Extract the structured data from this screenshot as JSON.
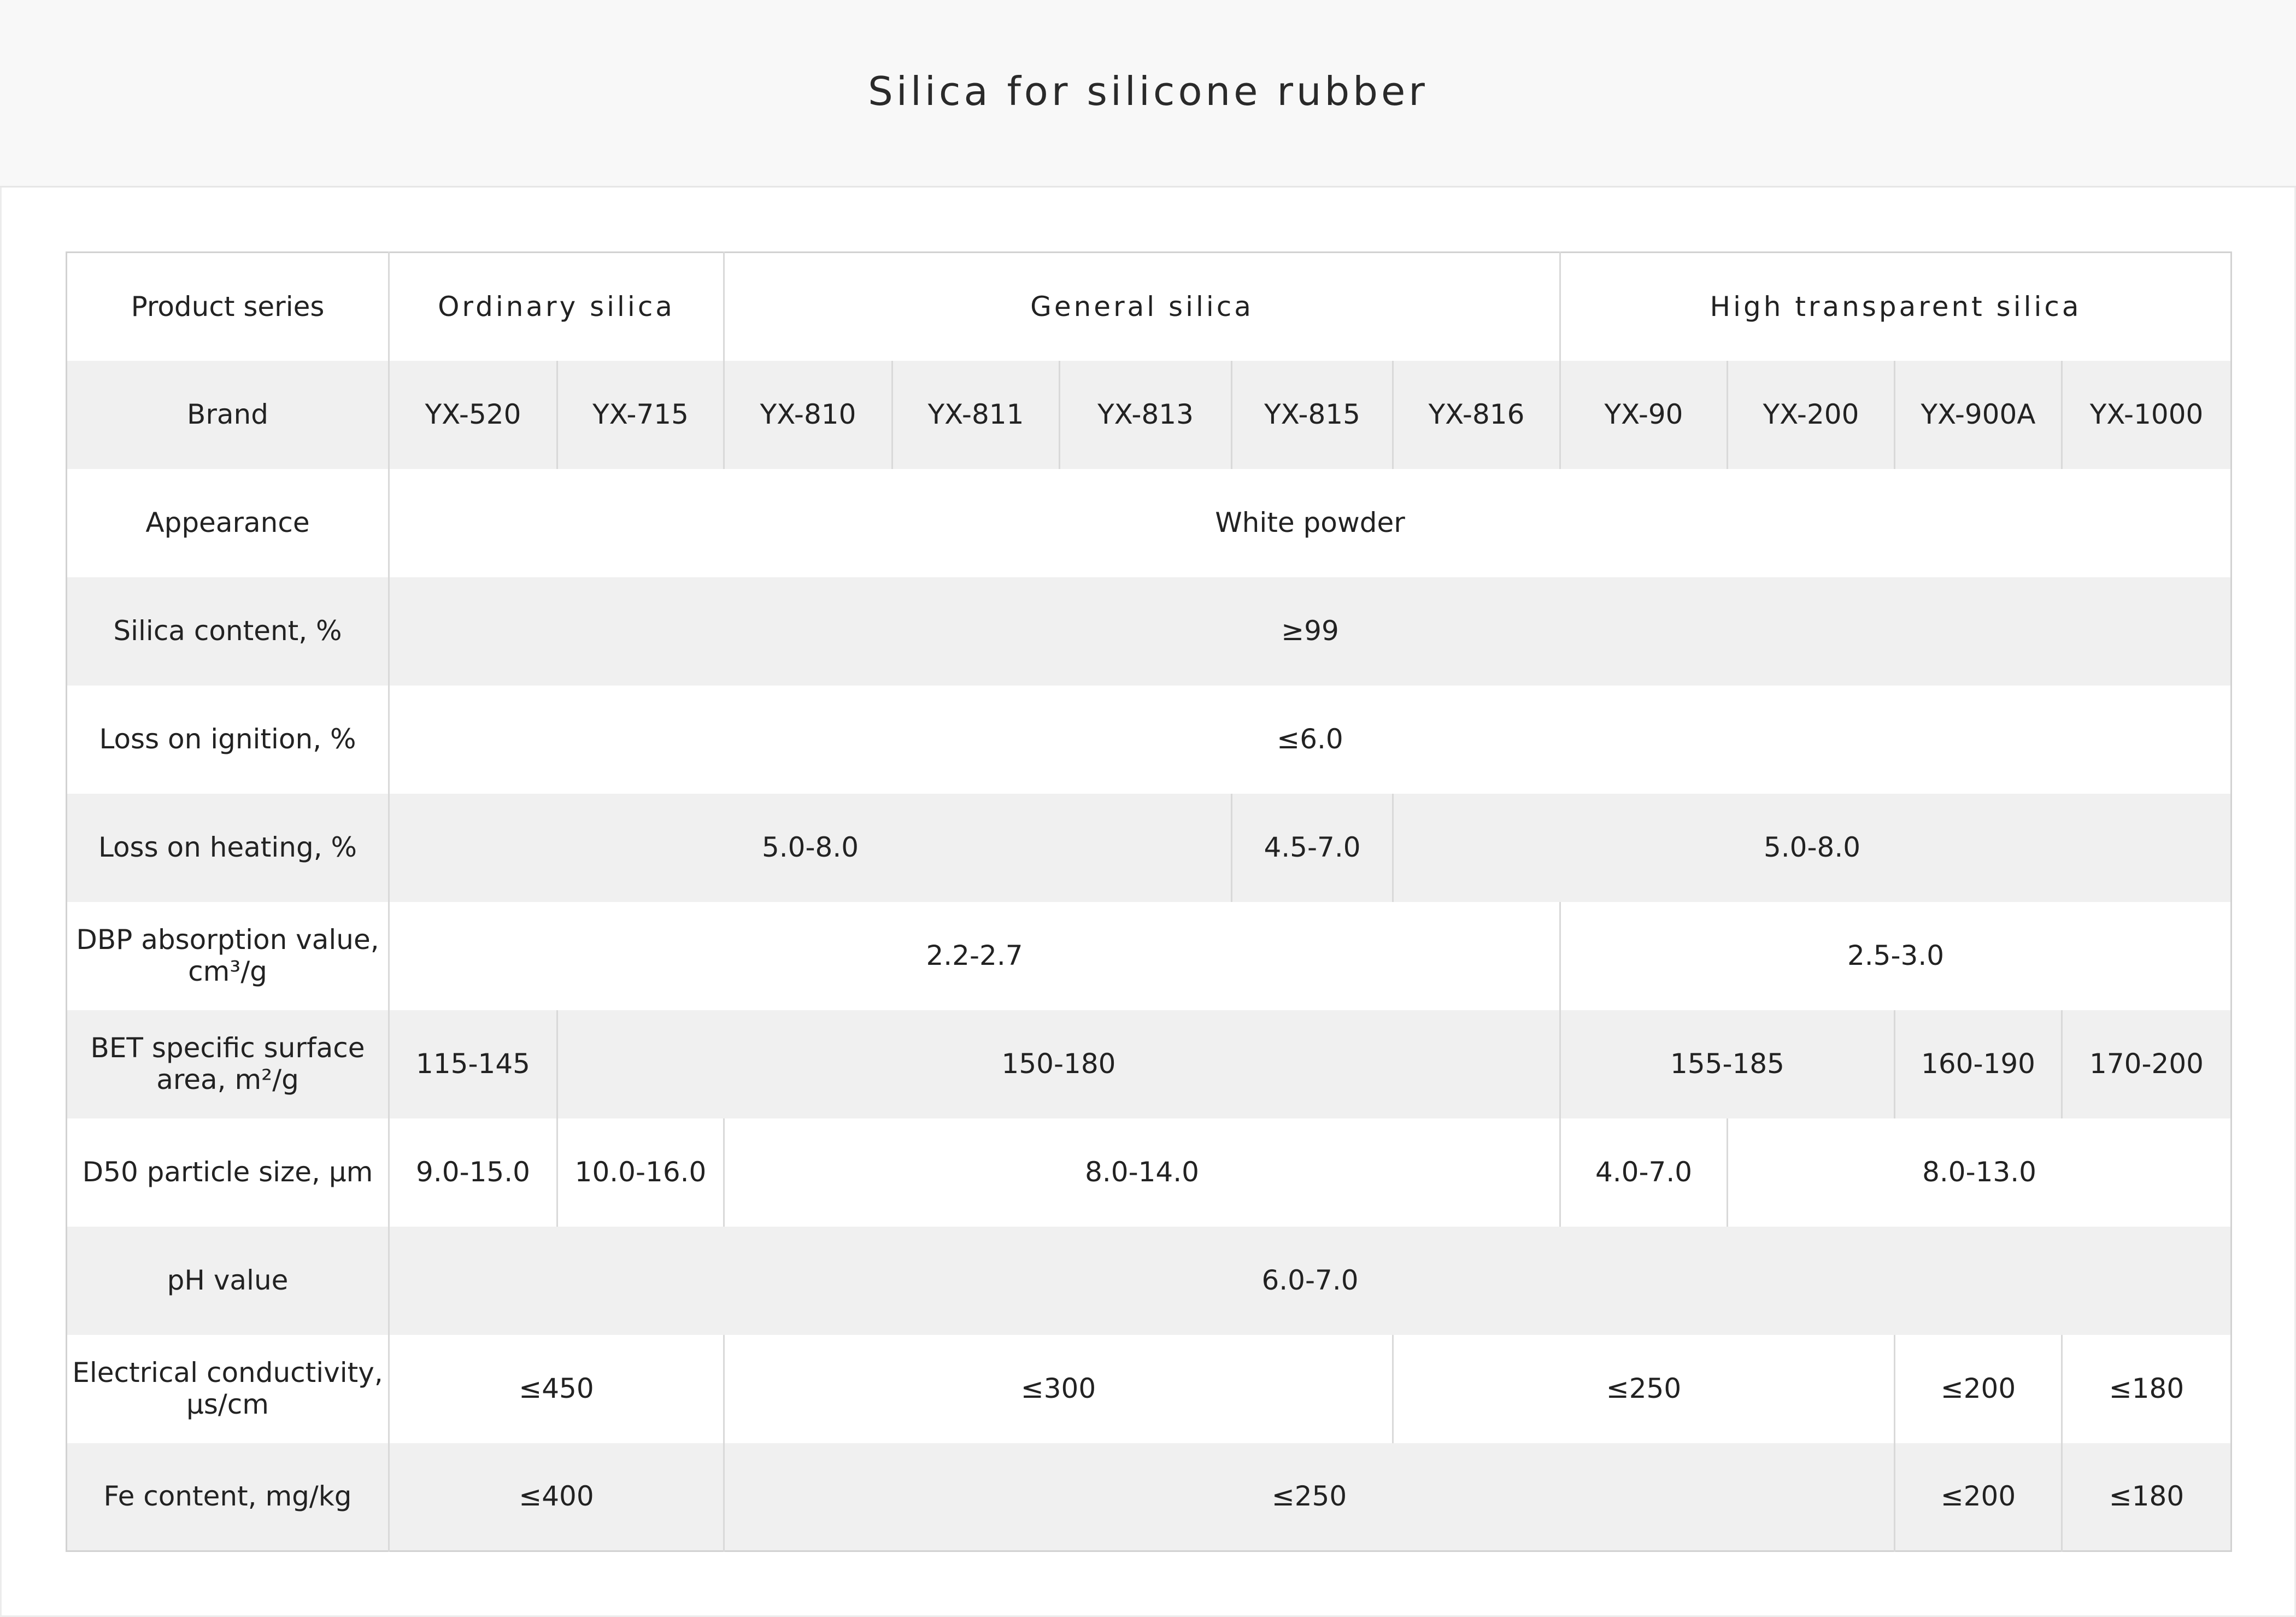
{
  "page": {
    "title": "Silica for silicone rubber"
  },
  "table": {
    "rows": {
      "series": {
        "label": "Product series",
        "cells": [
          "Ordinary silica",
          "General silica",
          "High transparent silica"
        ]
      },
      "brand": {
        "label": "Brand",
        "cells": [
          "YX-520",
          "YX-715",
          "YX-810",
          "YX-811",
          "YX-813",
          "YX-815",
          "YX-816",
          "YX-90",
          "YX-200",
          "YX-900A",
          "YX-1000"
        ]
      },
      "appearance": {
        "label": "Appearance",
        "cells": [
          "White powder"
        ]
      },
      "silica_content": {
        "label": "Silica content, %",
        "cells": [
          "≥99"
        ]
      },
      "loss_ignition": {
        "label": "Loss on ignition, %",
        "cells": [
          "≤6.0"
        ]
      },
      "loss_heating": {
        "label": "Loss on heating, %",
        "cells": [
          "5.0-8.0",
          "4.5-7.0",
          "5.0-8.0"
        ]
      },
      "dbp": {
        "label": "DBP absorption value, cm³/g",
        "cells": [
          "2.2-2.7",
          "2.5-3.0"
        ]
      },
      "bet": {
        "label": "BET specific surface area, m²/g",
        "cells": [
          "115-145",
          "150-180",
          "155-185",
          "160-190",
          "170-200"
        ]
      },
      "d50": {
        "label": "D50 particle size, μm",
        "cells": [
          "9.0-15.0",
          "10.0-16.0",
          "8.0-14.0",
          "4.0-7.0",
          "8.0-13.0"
        ]
      },
      "ph": {
        "label": "pH value",
        "cells": [
          "6.0-7.0"
        ]
      },
      "conductivity": {
        "label": "Electrical conductivity, μs/cm",
        "cells": [
          "≤450",
          "≤300",
          "≤250",
          "≤200",
          "≤180"
        ]
      },
      "fe": {
        "label": "Fe content, mg/kg",
        "cells": [
          "≤400",
          "≤250",
          "≤200",
          "≤180"
        ]
      }
    }
  }
}
